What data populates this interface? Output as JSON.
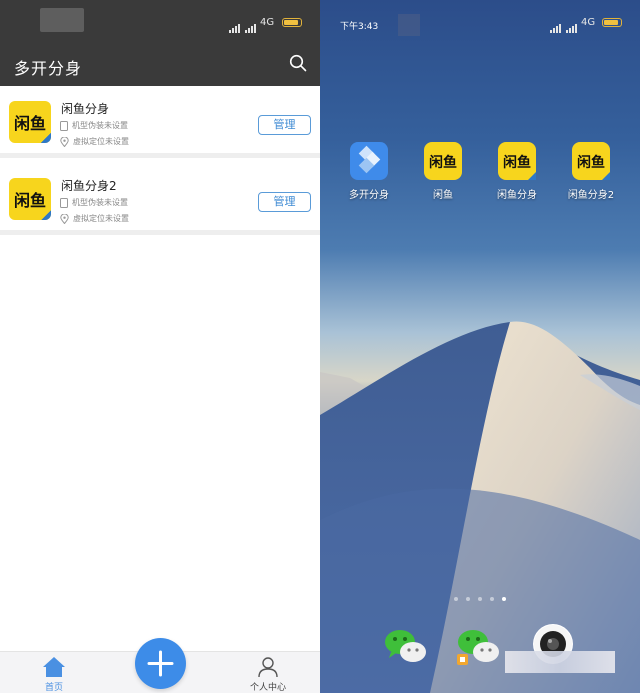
{
  "left": {
    "status": {
      "network": "4G"
    },
    "header": {
      "title": "多开分身"
    },
    "clones": [
      {
        "name": "闲鱼分身",
        "logo_text": "闲鱼",
        "device_status": "机型伪装未设置",
        "location_status": "虚拟定位未设置",
        "manage_label": "管理"
      },
      {
        "name": "闲鱼分身2",
        "logo_text": "闲鱼",
        "device_status": "机型伪装未设置",
        "location_status": "虚拟定位未设置",
        "manage_label": "管理"
      }
    ],
    "bottom_nav": {
      "home_label": "首页",
      "add_label": "+",
      "profile_label": "个人中心"
    }
  },
  "right": {
    "status": {
      "time": "下午3:43",
      "network": "4G"
    },
    "apps": [
      {
        "label": "多开分身",
        "icon": "multi-clone-app-icon"
      },
      {
        "label": "闲鱼",
        "icon": "xianyu-app-icon"
      },
      {
        "label": "闲鱼分身",
        "icon": "xianyu-app-icon"
      },
      {
        "label": "闲鱼分身2",
        "icon": "xianyu-app-icon"
      }
    ],
    "dock": [
      {
        "icon": "wechat-icon"
      },
      {
        "icon": "wechat-clone-icon"
      },
      {
        "icon": "camera-icon"
      }
    ]
  },
  "colors": {
    "accent": "#3d8ce8",
    "brand_yellow": "#f7d51d",
    "header_dark": "#3a3a3a"
  }
}
